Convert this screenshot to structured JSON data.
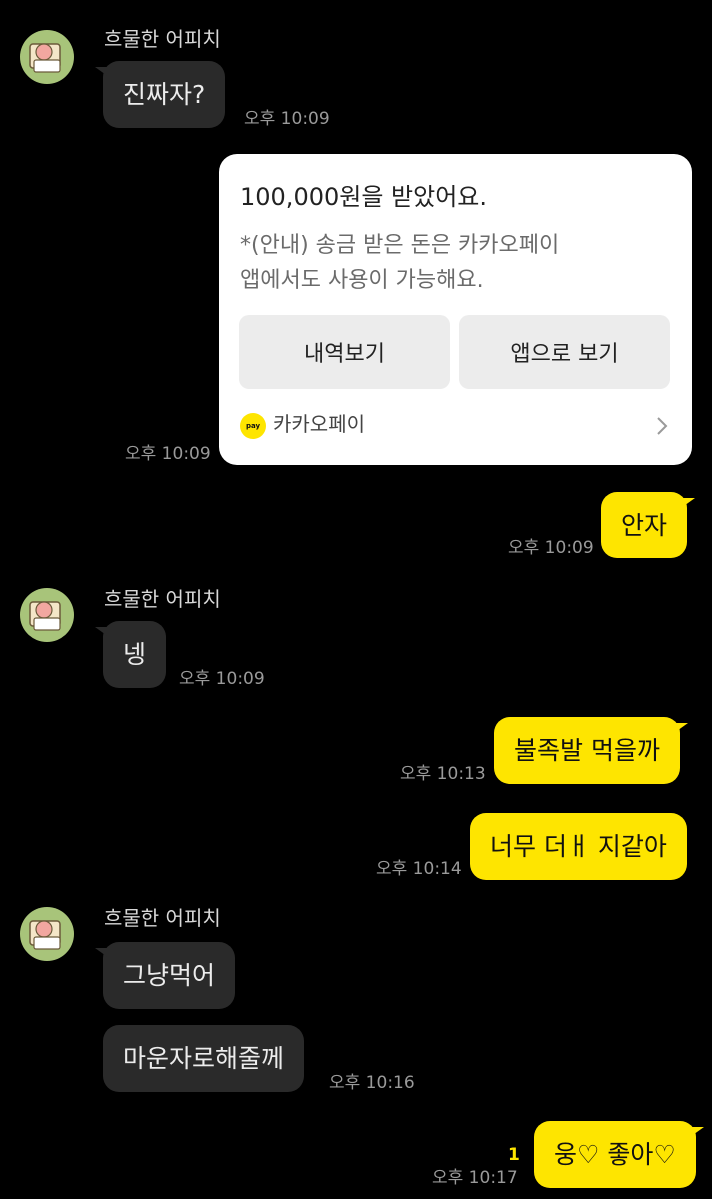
{
  "sender_name": "흐물한 어피치",
  "messages": {
    "m1": {
      "text": "진짜자?",
      "time": "오후 10:09"
    },
    "pay": {
      "title": "100,000원을 받았어요.",
      "note_line1": "*(안내) 송금 받은 돈은 카카오페이",
      "note_line2": "앱에서도 사용이 가능해요.",
      "btn_history": "내역보기",
      "btn_app": "앱으로 보기",
      "brand": "카카오페이",
      "logo_text": "pay",
      "time": "오후 10:09"
    },
    "m3": {
      "text": "안자",
      "time": "오후 10:09"
    },
    "m4": {
      "text": "넹",
      "time": "오후 10:09"
    },
    "m5": {
      "text": "불족발 먹을까",
      "time": "오후 10:13"
    },
    "m6": {
      "text": "너무 더ㅐ 지같아",
      "time": "오후 10:14"
    },
    "m7": {
      "text": "그냥먹어"
    },
    "m8": {
      "text": "마운자로해줄께",
      "time": "오후 10:16"
    },
    "m9": {
      "text": "웅♡ 좋아♡",
      "time": "오후 10:17",
      "unread": "1"
    }
  },
  "colors": {
    "background": "#000000",
    "incoming_bubble": "#2a2a2a",
    "outgoing_bubble": "#fee500",
    "pay_card": "#ffffff",
    "avatar_bg": "#a8c47a"
  },
  "icons": {
    "avatar": "apeach-avatar-icon",
    "chevron": "chevron-right-icon",
    "pay_logo": "kakaopay-logo-icon"
  }
}
